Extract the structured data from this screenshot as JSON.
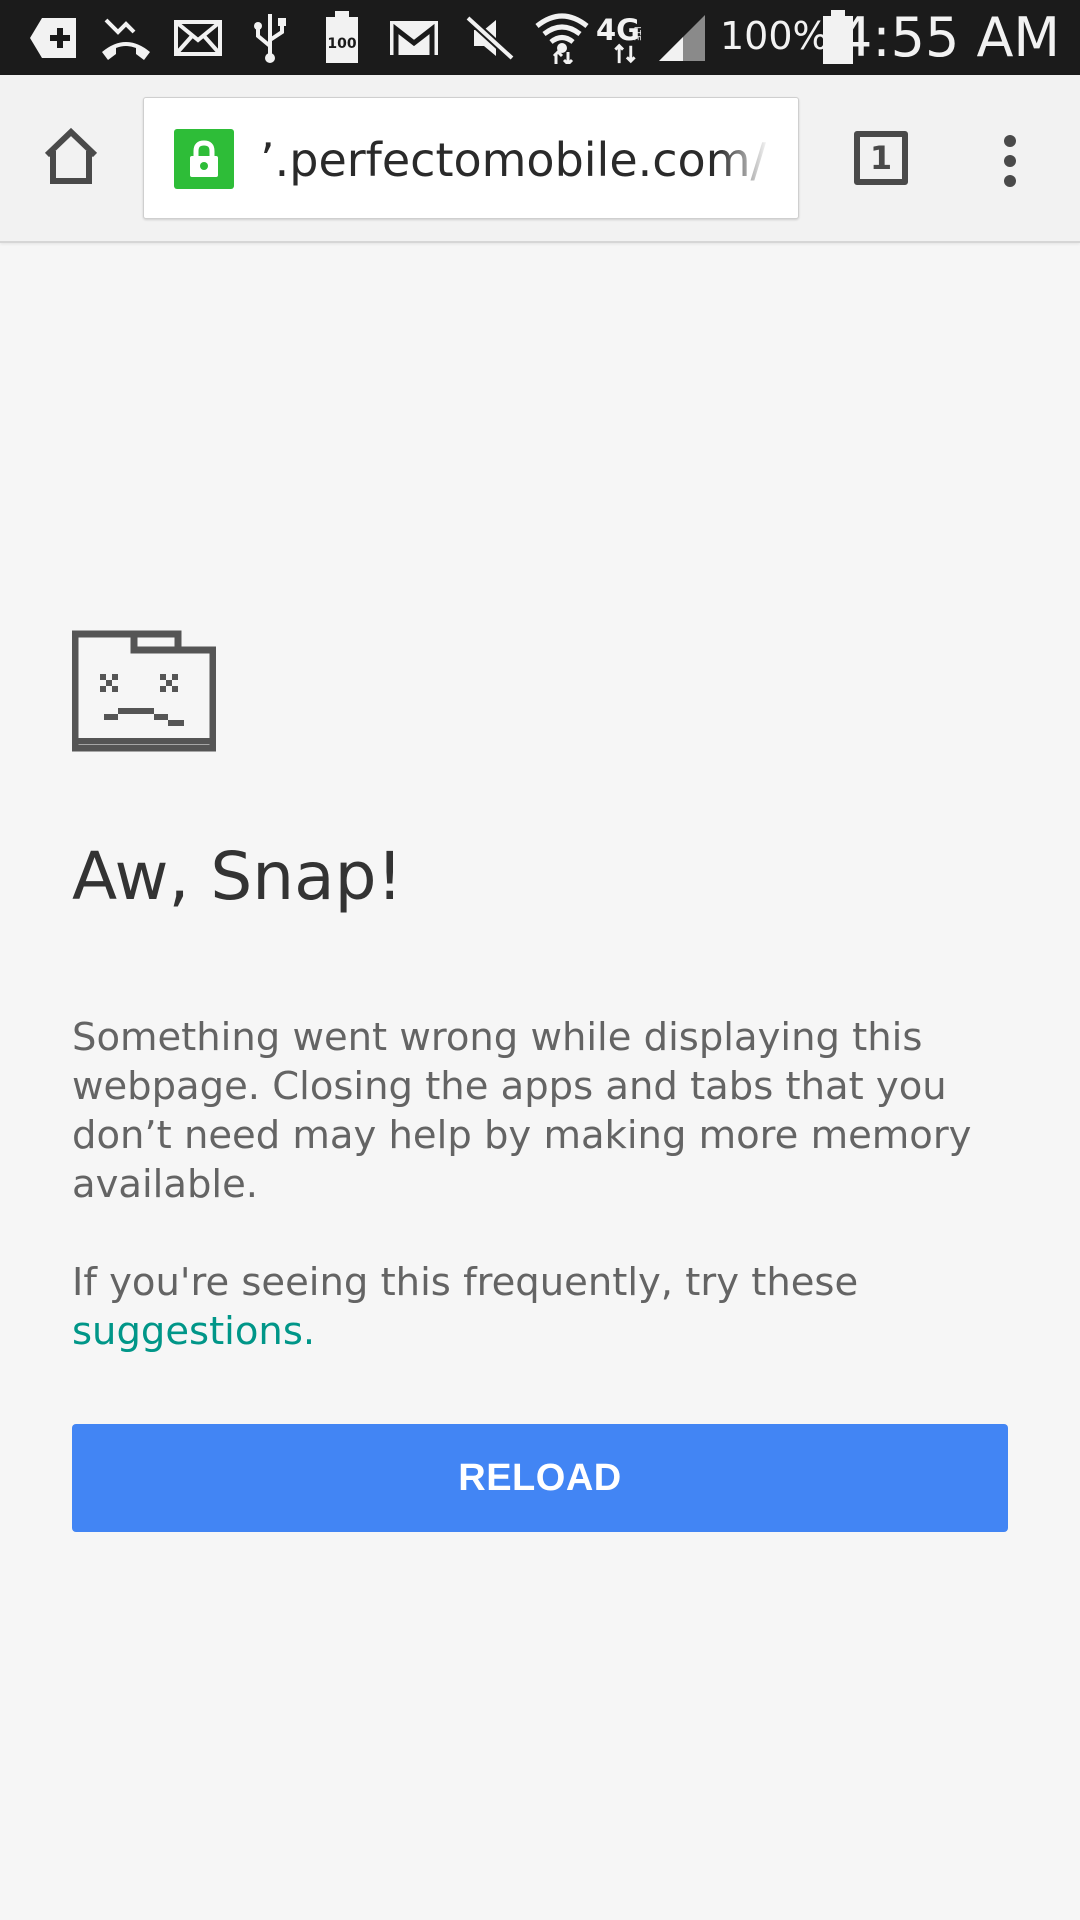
{
  "status_bar": {
    "icons": [
      "add-icon",
      "missed-call-icon",
      "email-icon",
      "usb-icon",
      "battery-100-icon",
      "gmail-icon",
      "mute-icon",
      "wifi-icon",
      "4g-lte-icon",
      "signal-icon",
      "battery-icon"
    ],
    "battery_percent": "100%",
    "time": "4:55 AM"
  },
  "toolbar": {
    "url": "www.perfectomobile.com/p",
    "url_visible": "’.perfectomobile.com/p",
    "secure": true,
    "tab_count": "1"
  },
  "error": {
    "title": "Aw, Snap!",
    "message": "Something went wrong while displaying this webpage. Closing the apps and tabs that you don’t need may help by making more memory available.",
    "suggestion_prefix": "If you're seeing this frequently, try these ",
    "suggestion_link": "suggestions",
    "suggestion_suffix": ".",
    "reload_label": "RELOAD"
  },
  "colors": {
    "status_bar_bg": "#1b1b1b",
    "lock_green": "#2ebd38",
    "link": "#009688",
    "reload_button": "#4285f4"
  }
}
